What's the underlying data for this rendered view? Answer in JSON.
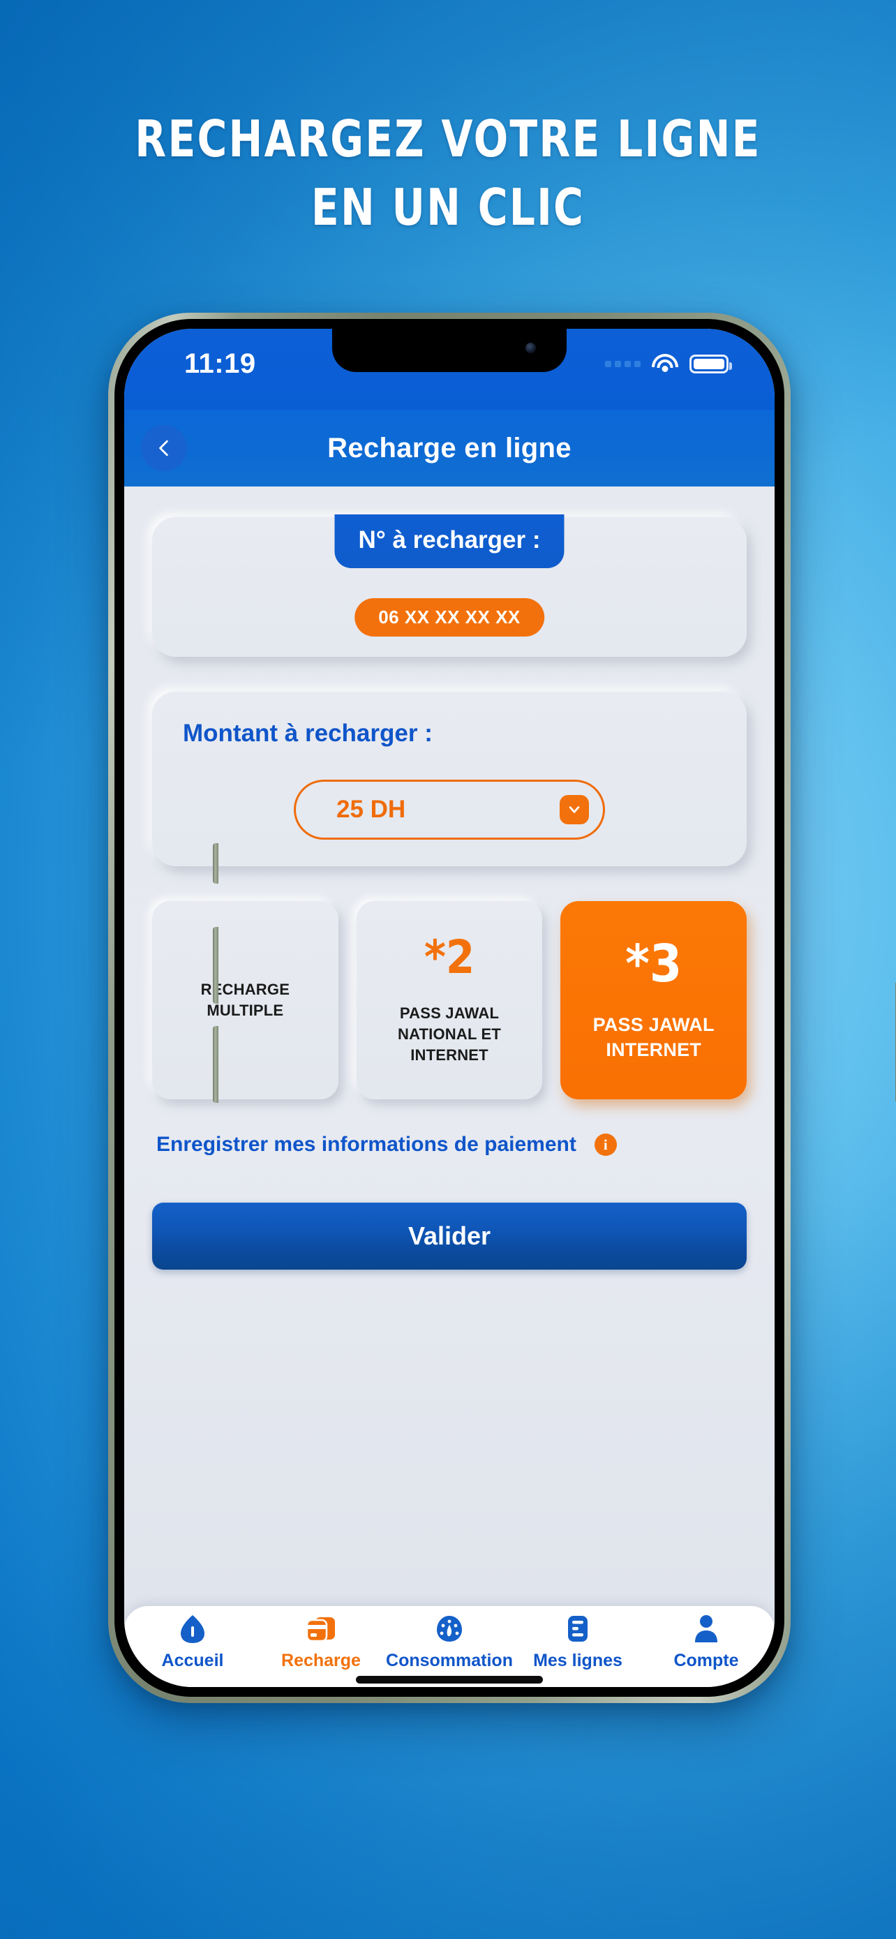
{
  "promo": {
    "headline_line1": "RECHARGEZ VOTRE LIGNE",
    "headline_line2": "EN UN CLIC"
  },
  "status_bar": {
    "time": "11:19",
    "signal_icon": "signal-dots-icon",
    "wifi_icon": "wifi-icon",
    "battery_icon": "battery-full-icon"
  },
  "header": {
    "back_icon": "chevron-left-icon",
    "title": "Recharge en ligne"
  },
  "number_card": {
    "tab_label": "N° à recharger :",
    "number": "06 XX XX XX XX"
  },
  "amount_card": {
    "label": "Montant à recharger :",
    "selected_value": "25 DH",
    "caret_icon": "chevron-down-icon"
  },
  "tiles": [
    {
      "star": "",
      "label": "RECHARGE MULTIPLE",
      "active": false
    },
    {
      "star": "*2",
      "label": "PASS JAWAL NATIONAL ET INTERNET",
      "active": false
    },
    {
      "star": "*3",
      "label": "PASS JAWAL INTERNET",
      "active": true
    }
  ],
  "save_payment": {
    "label": "Enregistrer mes informations de paiement",
    "info_icon": "info-icon",
    "info_glyph": "i"
  },
  "validate": {
    "label": "Valider"
  },
  "bottom_nav": [
    {
      "label": "Accueil",
      "icon": "home-icon",
      "active": false
    },
    {
      "label": "Recharge",
      "icon": "credit-card-icon",
      "active": true
    },
    {
      "label": "Consommation",
      "icon": "gauge-icon",
      "active": false
    },
    {
      "label": "Mes lignes",
      "icon": "list-lines-icon",
      "active": false
    },
    {
      "label": "Compte",
      "icon": "person-icon",
      "active": false
    }
  ],
  "colors": {
    "brand_blue": "#0f55c9",
    "header_blue": "#0b68d6",
    "accent_orange": "#f2710c",
    "screen_bg": "#e7eaf0",
    "background_blue": "#0a74c4"
  }
}
